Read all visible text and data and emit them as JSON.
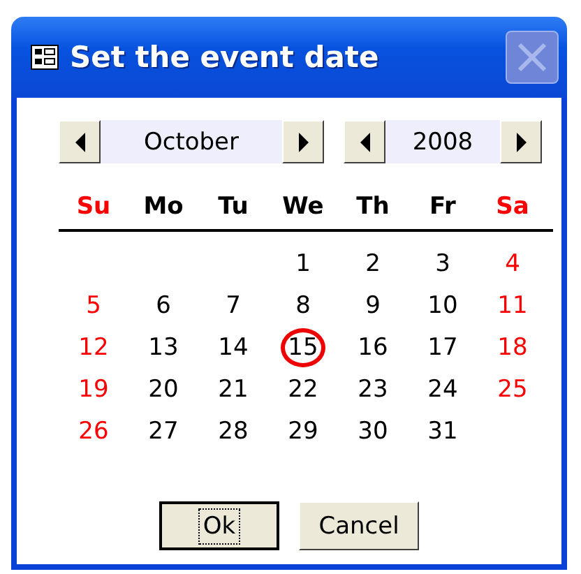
{
  "window": {
    "title": "Set the event date",
    "close_button": {
      "disabled": true
    }
  },
  "month": {
    "value": "October"
  },
  "year": {
    "value": "2008"
  },
  "weekdays": [
    {
      "label": "Su",
      "weekend": true
    },
    {
      "label": "Mo",
      "weekend": false
    },
    {
      "label": "Tu",
      "weekend": false
    },
    {
      "label": "We",
      "weekend": false
    },
    {
      "label": "Th",
      "weekend": false
    },
    {
      "label": "Fr",
      "weekend": false
    },
    {
      "label": "Sa",
      "weekend": true
    }
  ],
  "weeks": [
    {
      "days": [
        {
          "label": "1",
          "weekend": false,
          "selected": false
        },
        {
          "label": "2",
          "weekend": false,
          "selected": false
        },
        {
          "label": "3",
          "weekend": false,
          "selected": false
        },
        {
          "label": "4",
          "weekend": true,
          "selected": false
        }
      ]
    },
    {
      "days": [
        {
          "label": "5",
          "weekend": true,
          "selected": false
        },
        {
          "label": "6",
          "weekend": false,
          "selected": false
        },
        {
          "label": "7",
          "weekend": false,
          "selected": false
        },
        {
          "label": "8",
          "weekend": false,
          "selected": false
        },
        {
          "label": "9",
          "weekend": false,
          "selected": false
        },
        {
          "label": "10",
          "weekend": false,
          "selected": false
        },
        {
          "label": "11",
          "weekend": true,
          "selected": false
        }
      ]
    },
    {
      "days": [
        {
          "label": "12",
          "weekend": true,
          "selected": false
        },
        {
          "label": "13",
          "weekend": false,
          "selected": false
        },
        {
          "label": "14",
          "weekend": false,
          "selected": false
        },
        {
          "label": "15",
          "weekend": false,
          "selected": true
        },
        {
          "label": "16",
          "weekend": false,
          "selected": false
        },
        {
          "label": "17",
          "weekend": false,
          "selected": false
        },
        {
          "label": "18",
          "weekend": true,
          "selected": false
        }
      ]
    },
    {
      "days": [
        {
          "label": "19",
          "weekend": true,
          "selected": false
        },
        {
          "label": "20",
          "weekend": false,
          "selected": false
        },
        {
          "label": "21",
          "weekend": false,
          "selected": false
        },
        {
          "label": "22",
          "weekend": false,
          "selected": false
        },
        {
          "label": "23",
          "weekend": false,
          "selected": false
        },
        {
          "label": "24",
          "weekend": false,
          "selected": false
        },
        {
          "label": "25",
          "weekend": true,
          "selected": false
        }
      ]
    },
    {
      "days": [
        {
          "label": "26",
          "weekend": true,
          "selected": false
        },
        {
          "label": "27",
          "weekend": false,
          "selected": false
        },
        {
          "label": "28",
          "weekend": false,
          "selected": false
        },
        {
          "label": "29",
          "weekend": false,
          "selected": false
        },
        {
          "label": "30",
          "weekend": false,
          "selected": false
        },
        {
          "label": "31",
          "weekend": false,
          "selected": false
        }
      ]
    }
  ],
  "buttons": [
    {
      "label": "Ok",
      "default": true
    },
    {
      "label": "Cancel",
      "default": false
    }
  ]
}
